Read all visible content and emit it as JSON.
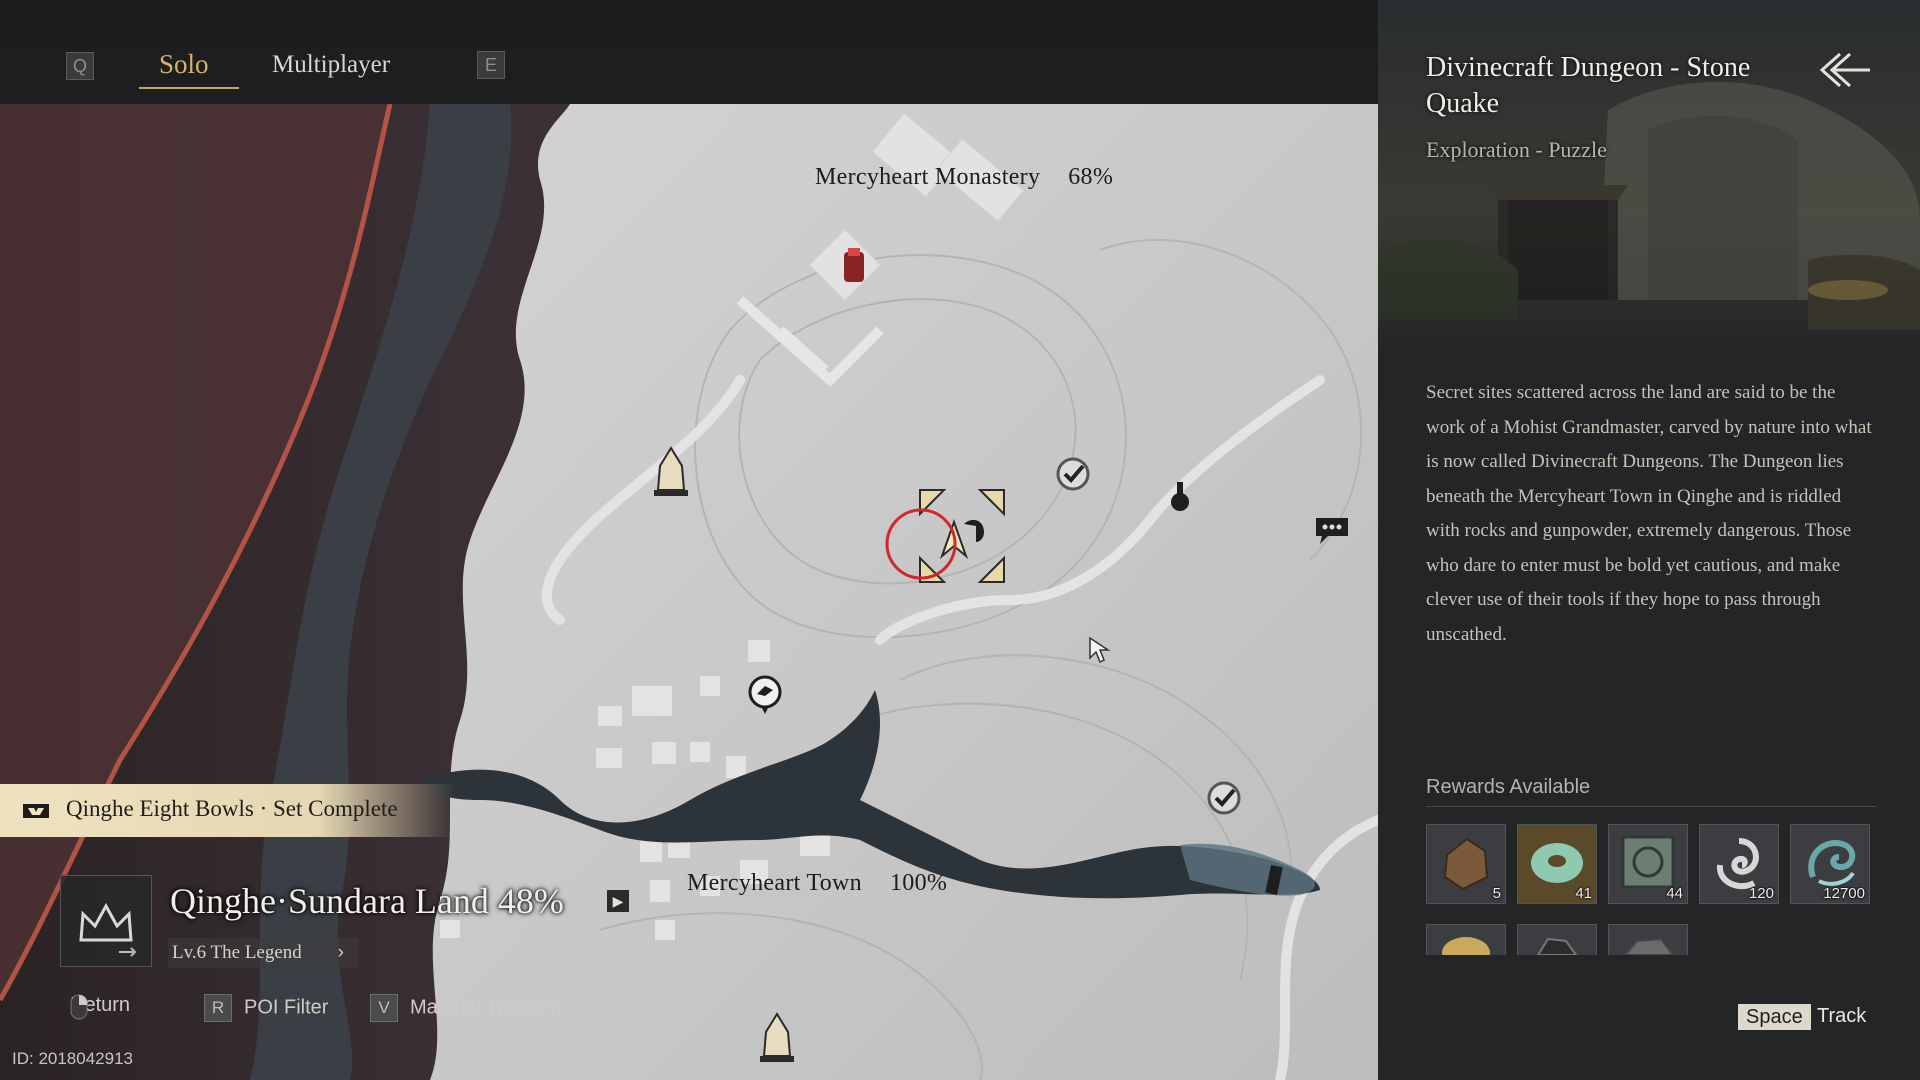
{
  "tabs": {
    "left_key": "Q",
    "solo": "Solo",
    "multiplayer": "Multiplayer",
    "right_key": "E"
  },
  "map": {
    "labels": {
      "monastery_name": "Mercyheart Monastery",
      "monastery_pct": "68%",
      "town_name": "Mercyheart Town",
      "town_pct": "100%"
    }
  },
  "banner": {
    "text": "Qinghe Eight Bowls · Set Complete"
  },
  "region": {
    "name": "Qinghe·Sundara Land 48%",
    "level": "Lv.6 The Legend",
    "arrow": "▶",
    "chevron": "›"
  },
  "hints": [
    {
      "key": "",
      "label": "Return"
    },
    {
      "key": "R",
      "label": "POI Filter"
    },
    {
      "key": "V",
      "label": "Material Tracking"
    }
  ],
  "player_id": "ID: 2018042913",
  "panel": {
    "title": "Divinecraft Dungeon - Stone Quake",
    "subtitle": "Exploration - Puzzle",
    "description": "Secret sites scattered across the land are said to be the work of a Mohist Grandmaster, carved by nature into what is now called Divinecraft Dungeons. The Dungeon lies beneath the Mercyheart Town in Qinghe and is riddled with rocks and gunpowder, extremely dangerous. Those who dare to enter must be bold yet cautious, and make clever use of their tools if they hope to pass through unscathed.",
    "rewards_title": "Rewards Available",
    "rewards": [
      {
        "icon": "ore-chunk-icon",
        "count": "5",
        "color": "#7a5a3a"
      },
      {
        "icon": "jade-disc-icon",
        "count": "41",
        "color": "#8fc9b1"
      },
      {
        "icon": "bronze-seal-icon",
        "count": "44",
        "color": "#6d7d74"
      },
      {
        "icon": "spiral-cloud-icon",
        "count": "120",
        "color": "#d7d7d7"
      },
      {
        "icon": "dragon-swirl-icon",
        "count": "12700",
        "color": "#6aa7a9"
      }
    ],
    "rewards_row2": [
      {
        "icon": "gold-coin-icon",
        "color": "#c9a95a"
      },
      {
        "icon": "dark-material-icon",
        "color": "#2c2c2c"
      },
      {
        "icon": "grey-ore-icon",
        "color": "#6b6b6b"
      }
    ],
    "track_key": "Space",
    "track_label": "Track"
  },
  "colors": {
    "accent_gold": "#d6b06a",
    "map_paper": "#c9c9c9",
    "sea": "#2a3036",
    "shoreline": "#c85a4a",
    "cursor_ring": "#d3272a"
  }
}
